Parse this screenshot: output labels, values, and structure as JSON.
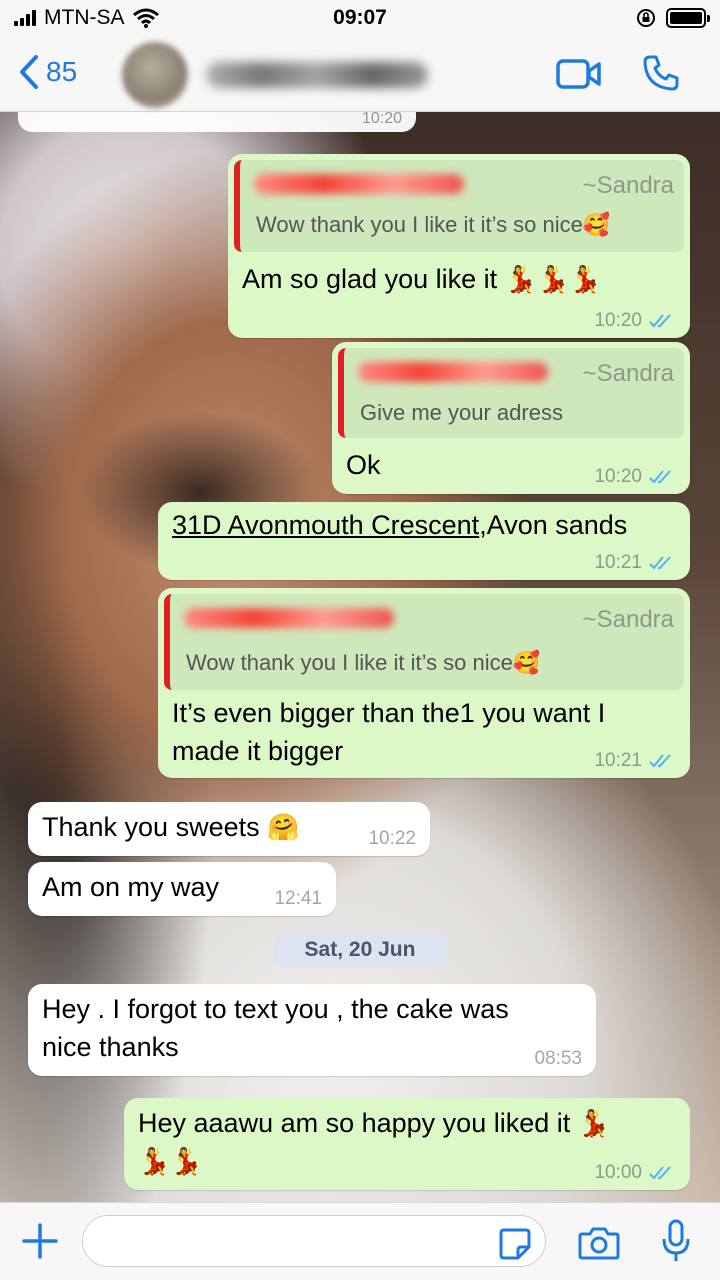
{
  "status_bar": {
    "carrier": "MTN-SA",
    "time": "09:07"
  },
  "header": {
    "back_count": "85"
  },
  "chat": {
    "prev_time": "10:20",
    "messages": [
      {
        "quote_author": "~Sandra",
        "quote_text": "Wow thank you I like it it’s so nice🥰",
        "text": "Am so glad you like it",
        "emoji": "💃💃💃",
        "time": "10:20"
      },
      {
        "quote_author": "~Sandra",
        "quote_text": "Give me your adress",
        "text": "Ok",
        "time": "10:20"
      },
      {
        "text_link": "31D Avonmouth Crescent",
        "text_rest": ",Avon sands",
        "time": "10:21"
      },
      {
        "quote_author": "~Sandra",
        "quote_text": "Wow thank you I like it it’s so nice🥰",
        "line1": "It’s even bigger than the1 you want I",
        "line2": "made it bigger",
        "time": "10:21"
      },
      {
        "text": "Thank you sweets",
        "emoji": "🤗",
        "time": "10:22"
      },
      {
        "text": "Am on my way",
        "time": "12:41"
      },
      {
        "line1": "Hey . I forgot to text you , the cake was",
        "line2": "nice thanks",
        "time": "08:53"
      },
      {
        "line1": "Hey aaawu am so happy you liked it",
        "emoji1": "💃",
        "emoji2": "💃💃",
        "time": "10:00"
      }
    ],
    "date_separator": "Sat, 20 Jun"
  },
  "colors": {
    "accent": "#1f7ae0",
    "outgoing": "#dcf8c6",
    "incoming": "#ffffff",
    "read_ticks": "#4fb3f2",
    "quote_bar": "#e02020"
  },
  "icons": [
    "signal-icon",
    "wifi-icon",
    "lock-rotation-icon",
    "battery-icon",
    "back-chevron-icon",
    "video-call-icon",
    "phone-icon",
    "read-ticks-icon",
    "plus-icon",
    "sticker-icon",
    "camera-icon",
    "microphone-icon"
  ]
}
